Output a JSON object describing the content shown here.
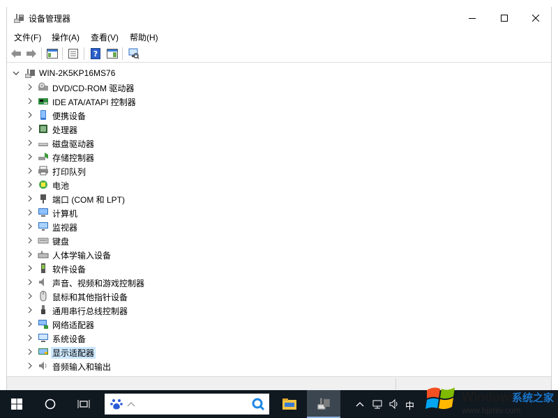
{
  "window": {
    "title": "设备管理器",
    "menus": [
      "文件(F)",
      "操作(A)",
      "查看(V)",
      "帮助(H)"
    ]
  },
  "tree": {
    "root": "WIN-2K5KP16MS76",
    "items": [
      {
        "label": "DVD/CD-ROM 驱动器",
        "icon": "dvd-drive-icon"
      },
      {
        "label": "IDE ATA/ATAPI 控制器",
        "icon": "ide-controller-icon"
      },
      {
        "label": "便携设备",
        "icon": "portable-device-icon"
      },
      {
        "label": "处理器",
        "icon": "processor-icon"
      },
      {
        "label": "磁盘驱动器",
        "icon": "disk-drive-icon"
      },
      {
        "label": "存储控制器",
        "icon": "storage-controller-icon"
      },
      {
        "label": "打印队列",
        "icon": "printer-icon"
      },
      {
        "label": "电池",
        "icon": "battery-icon"
      },
      {
        "label": "端口 (COM 和 LPT)",
        "icon": "port-icon"
      },
      {
        "label": "计算机",
        "icon": "computer-icon"
      },
      {
        "label": "监视器",
        "icon": "monitor-icon"
      },
      {
        "label": "键盘",
        "icon": "keyboard-icon"
      },
      {
        "label": "人体学输入设备",
        "icon": "hid-icon"
      },
      {
        "label": "软件设备",
        "icon": "software-device-icon"
      },
      {
        "label": "声音、视频和游戏控制器",
        "icon": "sound-icon"
      },
      {
        "label": "鼠标和其他指针设备",
        "icon": "mouse-icon"
      },
      {
        "label": "通用串行总线控制器",
        "icon": "usb-icon"
      },
      {
        "label": "网络适配器",
        "icon": "network-adapter-icon"
      },
      {
        "label": "系统设备",
        "icon": "system-device-icon"
      },
      {
        "label": "显示适配器",
        "icon": "display-adapter-icon",
        "selected": true
      },
      {
        "label": "音频输入和输出",
        "icon": "audio-io-icon"
      }
    ]
  },
  "taskbar": {
    "ime_label": "中"
  },
  "watermark": {
    "brand": "Windows",
    "brand_cn": "系统之家",
    "url": "www.bjjmlv.com"
  },
  "colors": {
    "selection": "#cce8ff",
    "taskbar": "#101820",
    "accent": "#1a75c9"
  }
}
